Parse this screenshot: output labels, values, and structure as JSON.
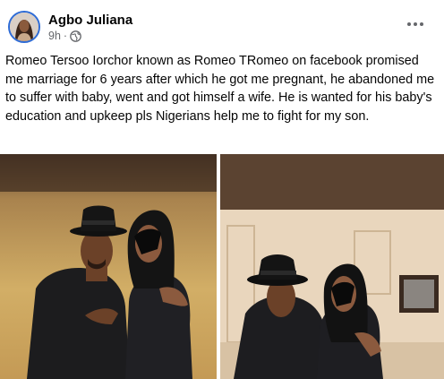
{
  "post": {
    "author": "Agbo Juliana",
    "time": "9h",
    "separator": "·",
    "privacy_icon": "globe-icon",
    "more_icon": "more-dots-icon",
    "text": "Romeo Tersoo Iorchor known as Romeo TRomeo on facebook promised me marriage for 6 years after which he got me pregnant, he abandoned me to suffer with baby, went and got himself a wife. He is wanted for his baby's education and upkeep pls Nigerians help me to fight for my son."
  },
  "photos": [
    {
      "name": "couple-photo-1"
    },
    {
      "name": "couple-photo-2"
    }
  ],
  "colors": {
    "name_text": "#050505",
    "meta_text": "#65676b",
    "avatar_ring": "#2d6bd6"
  }
}
